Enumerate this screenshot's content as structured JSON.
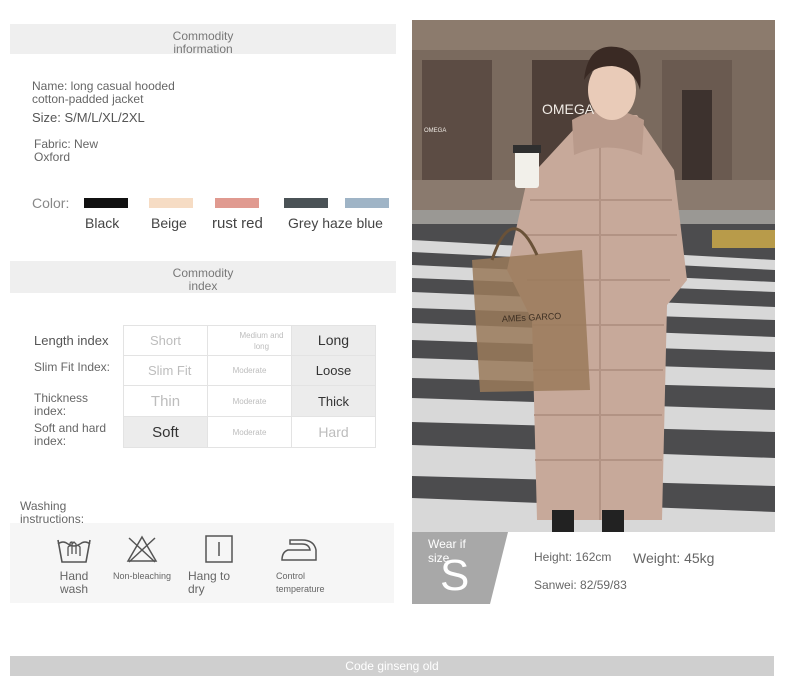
{
  "commodity_information": {
    "heading": "Commodity information",
    "name": "Name: long casual hooded cotton-padded jacket",
    "size": "Size: S/M/L/XL/2XL",
    "fabric": "Fabric: New Oxford",
    "color_label": "Color:",
    "colors": [
      {
        "name": "Black",
        "hex": "#111111"
      },
      {
        "name": "Beige",
        "hex": "#f6dcc4"
      },
      {
        "name": "rust red",
        "hex": "#e09a90"
      },
      {
        "name": "Grey haze blue",
        "hex": "#4a5256",
        "hex2": "#9fb4c6"
      }
    ]
  },
  "commodity_index": {
    "heading": "Commodity index",
    "rows": [
      {
        "label": "Length index",
        "options": [
          "Short",
          "Medium and long",
          "Long"
        ],
        "selected": 2
      },
      {
        "label": "Slim Fit Index:",
        "options": [
          "Slim Fit",
          "Moderate",
          "Loose"
        ],
        "selected": 2
      },
      {
        "label": "Thickness index:",
        "options": [
          "Thin",
          "Moderate",
          "Thick"
        ],
        "selected": 2
      },
      {
        "label": "Soft and hard index:",
        "options": [
          "Soft",
          "Moderate",
          "Hard"
        ],
        "selected": 0
      }
    ]
  },
  "washing": {
    "heading": "Washing instructions:",
    "items": [
      {
        "label": "Hand wash",
        "icon": "hand-wash-icon"
      },
      {
        "label": "Non-bleaching",
        "icon": "non-bleach-icon"
      },
      {
        "label": "Hang to dry",
        "icon": "hang-dry-icon"
      },
      {
        "label": "Control temperature",
        "icon": "iron-icon"
      }
    ]
  },
  "model": {
    "wear_label": "Wear if size",
    "size_letter": "S",
    "height": "Height: 162cm",
    "weight": "Weight: 45kg",
    "sanwei": "Sanwei: 82/59/83",
    "photo_text": [
      "OMEGA",
      "OMEGA",
      "AMEs GARCO"
    ]
  },
  "footer": {
    "label": "Code ginseng old"
  }
}
